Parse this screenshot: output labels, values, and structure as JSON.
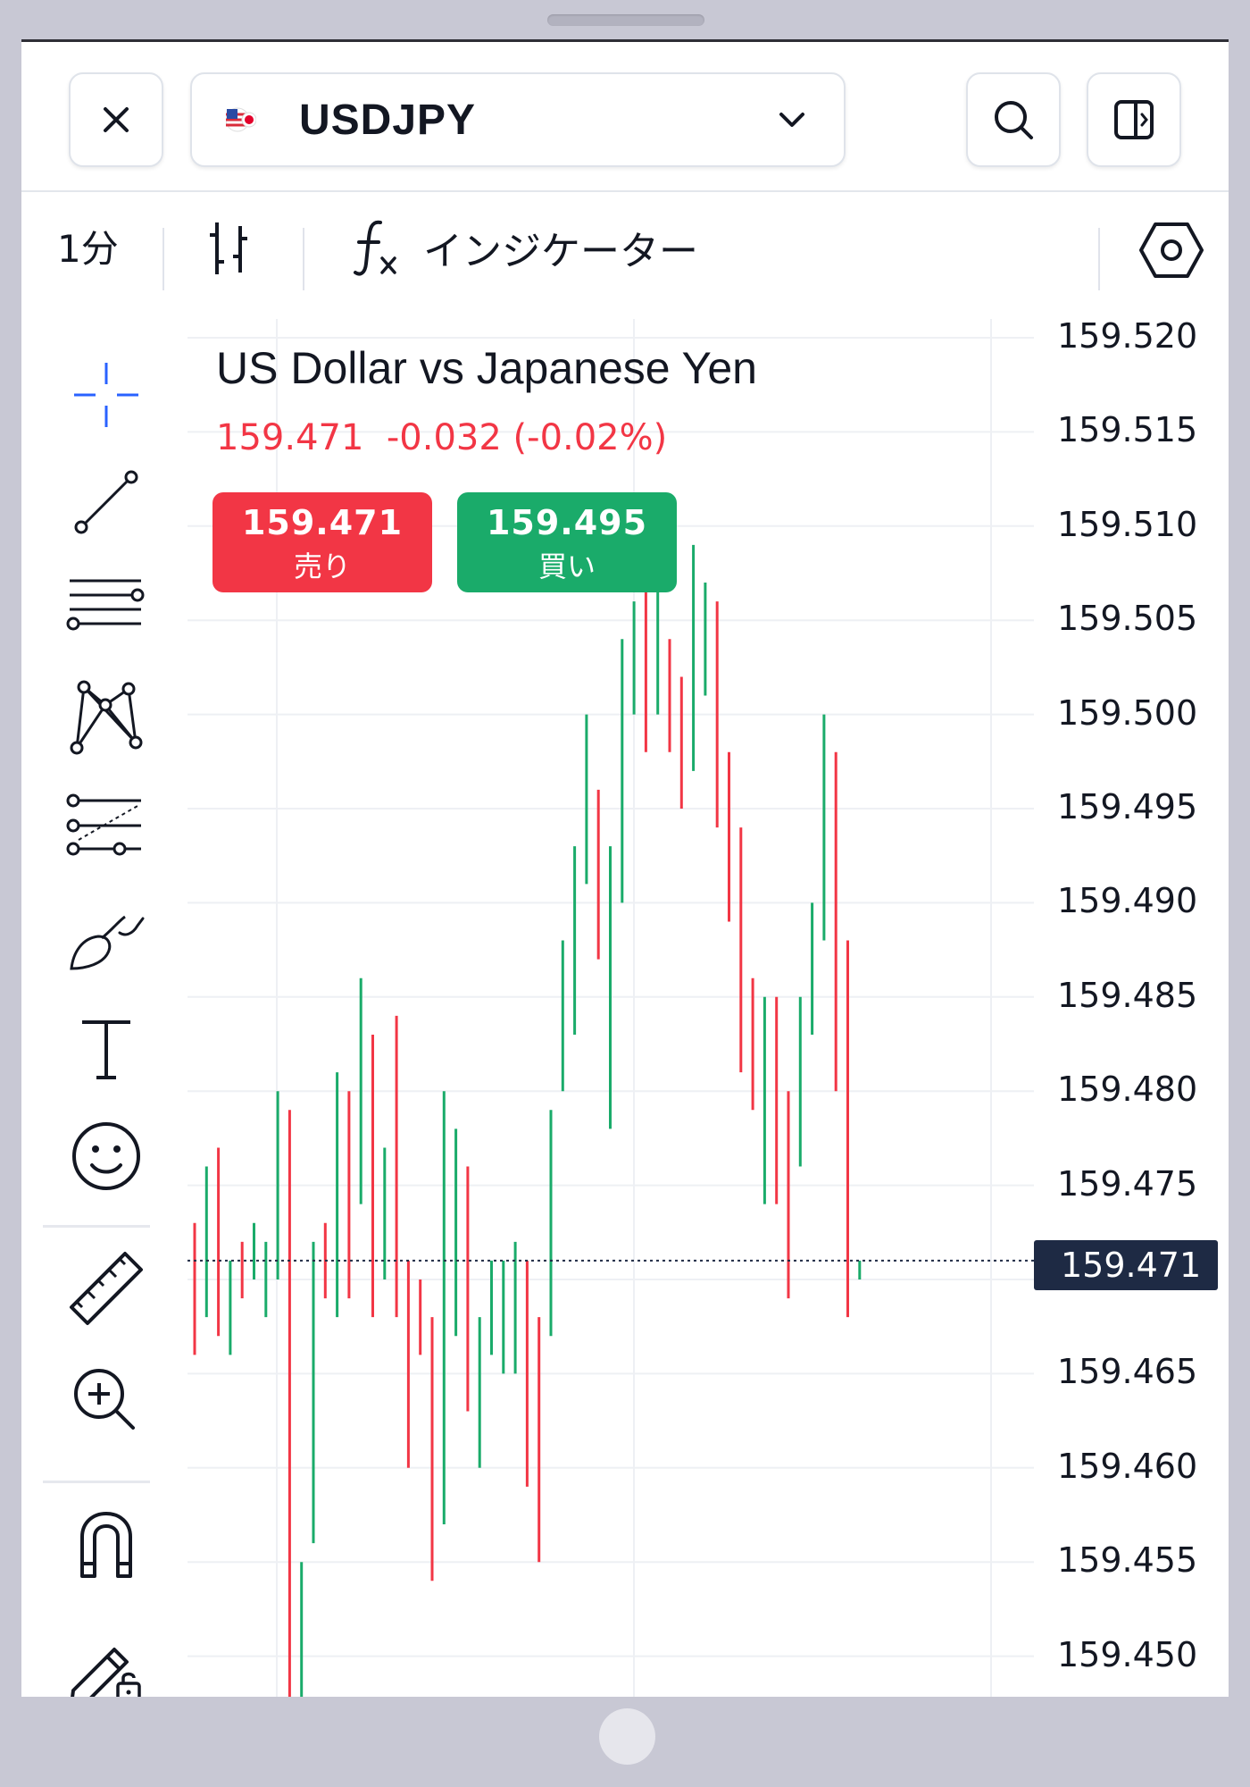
{
  "topbar": {
    "symbol": "USDJPY"
  },
  "toolbar": {
    "timeframe": "1分",
    "indicators_label": "インジケーター"
  },
  "header": {
    "title": "US Dollar vs Japanese Yen",
    "last": "159.471",
    "change": "-0.032",
    "change_pct": "(-0.02%)"
  },
  "trade": {
    "sell_price": "159.471",
    "sell_label": "売り",
    "buy_price": "159.495",
    "buy_label": "買い"
  },
  "colors": {
    "up": "#1aab6a",
    "down": "#f23645",
    "accent": "#2962ff",
    "badge": "#1e2a44"
  },
  "left_tools": [
    "crosshair-icon",
    "trend-line-icon",
    "parallel-channel-icon",
    "pattern-icon",
    "fib-retracement-icon",
    "brush-icon",
    "text-icon",
    "emoji-icon",
    "ruler-icon",
    "zoom-in-icon",
    "magnet-icon",
    "lock-drawings-icon"
  ],
  "chart_data": {
    "type": "ohlc-bars",
    "ylim": [
      159.45,
      159.52
    ],
    "yticks": [
      "159.520",
      "159.515",
      "159.510",
      "159.505",
      "159.500",
      "159.495",
      "159.490",
      "159.485",
      "159.480",
      "159.475",
      "159.470",
      "159.465",
      "159.460",
      "159.455",
      "159.450"
    ],
    "last_price": "159.471",
    "bars": [
      {
        "low": 159.466,
        "high": 159.473,
        "up": false
      },
      {
        "low": 159.468,
        "high": 159.476,
        "up": true
      },
      {
        "low": 159.467,
        "high": 159.477,
        "up": false
      },
      {
        "low": 159.466,
        "high": 159.471,
        "up": true
      },
      {
        "low": 159.469,
        "high": 159.472,
        "up": false
      },
      {
        "low": 159.47,
        "high": 159.473,
        "up": true
      },
      {
        "low": 159.468,
        "high": 159.472,
        "up": true
      },
      {
        "low": 159.47,
        "high": 159.48,
        "up": true
      },
      {
        "low": 159.447,
        "high": 159.479,
        "up": false
      },
      {
        "low": 159.447,
        "high": 159.455,
        "up": true
      },
      {
        "low": 159.456,
        "high": 159.472,
        "up": true
      },
      {
        "low": 159.469,
        "high": 159.473,
        "up": false
      },
      {
        "low": 159.468,
        "high": 159.481,
        "up": true
      },
      {
        "low": 159.469,
        "high": 159.48,
        "up": false
      },
      {
        "low": 159.474,
        "high": 159.486,
        "up": true
      },
      {
        "low": 159.468,
        "high": 159.483,
        "up": false
      },
      {
        "low": 159.47,
        "high": 159.477,
        "up": true
      },
      {
        "low": 159.468,
        "high": 159.484,
        "up": false
      },
      {
        "low": 159.46,
        "high": 159.471,
        "up": false
      },
      {
        "low": 159.466,
        "high": 159.47,
        "up": false
      },
      {
        "low": 159.454,
        "high": 159.468,
        "up": false
      },
      {
        "low": 159.457,
        "high": 159.48,
        "up": true
      },
      {
        "low": 159.467,
        "high": 159.478,
        "up": true
      },
      {
        "low": 159.463,
        "high": 159.476,
        "up": false
      },
      {
        "low": 159.46,
        "high": 159.468,
        "up": true
      },
      {
        "low": 159.466,
        "high": 159.471,
        "up": true
      },
      {
        "low": 159.465,
        "high": 159.471,
        "up": true
      },
      {
        "low": 159.465,
        "high": 159.472,
        "up": true
      },
      {
        "low": 159.459,
        "high": 159.471,
        "up": false
      },
      {
        "low": 159.455,
        "high": 159.468,
        "up": false
      },
      {
        "low": 159.467,
        "high": 159.479,
        "up": true
      },
      {
        "low": 159.48,
        "high": 159.488,
        "up": true
      },
      {
        "low": 159.483,
        "high": 159.493,
        "up": true
      },
      {
        "low": 159.491,
        "high": 159.5,
        "up": true
      },
      {
        "low": 159.487,
        "high": 159.496,
        "up": false
      },
      {
        "low": 159.478,
        "high": 159.493,
        "up": true
      },
      {
        "low": 159.49,
        "high": 159.504,
        "up": true
      },
      {
        "low": 159.5,
        "high": 159.506,
        "up": true
      },
      {
        "low": 159.498,
        "high": 159.511,
        "up": false
      },
      {
        "low": 159.5,
        "high": 159.508,
        "up": true
      },
      {
        "low": 159.498,
        "high": 159.504,
        "up": false
      },
      {
        "low": 159.495,
        "high": 159.502,
        "up": false
      },
      {
        "low": 159.497,
        "high": 159.509,
        "up": true
      },
      {
        "low": 159.501,
        "high": 159.507,
        "up": true
      },
      {
        "low": 159.494,
        "high": 159.506,
        "up": false
      },
      {
        "low": 159.489,
        "high": 159.498,
        "up": false
      },
      {
        "low": 159.481,
        "high": 159.494,
        "up": false
      },
      {
        "low": 159.479,
        "high": 159.486,
        "up": false
      },
      {
        "low": 159.474,
        "high": 159.485,
        "up": true
      },
      {
        "low": 159.474,
        "high": 159.485,
        "up": false
      },
      {
        "low": 159.469,
        "high": 159.48,
        "up": false
      },
      {
        "low": 159.476,
        "high": 159.485,
        "up": true
      },
      {
        "low": 159.483,
        "high": 159.49,
        "up": true
      },
      {
        "low": 159.488,
        "high": 159.5,
        "up": true
      },
      {
        "low": 159.48,
        "high": 159.498,
        "up": false
      },
      {
        "low": 159.468,
        "high": 159.488,
        "up": false
      },
      {
        "low": 159.47,
        "high": 159.471,
        "up": true
      }
    ]
  }
}
